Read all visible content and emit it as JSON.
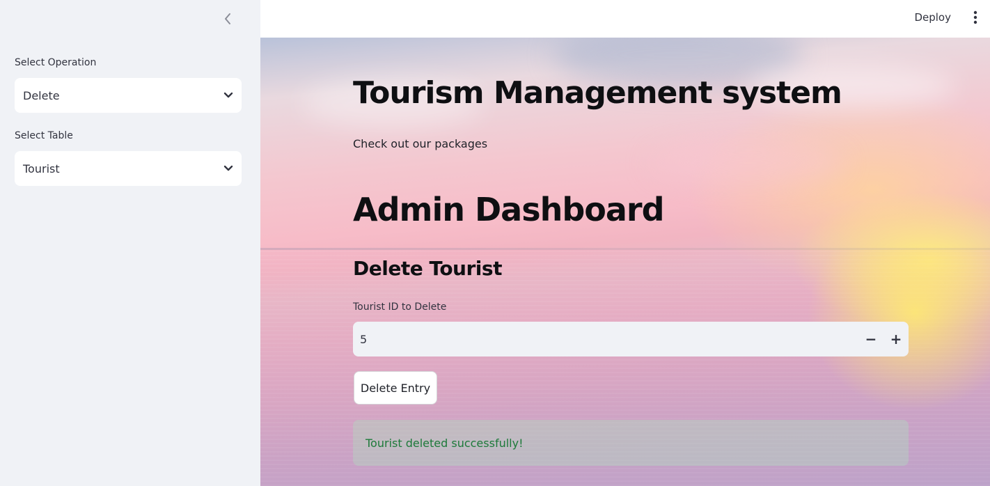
{
  "sidebar": {
    "collapse_icon": "chevron-left-icon",
    "operation": {
      "label": "Select Operation",
      "value": "Delete"
    },
    "table": {
      "label": "Select Table",
      "value": "Tourist"
    }
  },
  "header": {
    "deploy_label": "Deploy",
    "menu_icon": "kebab-menu-icon"
  },
  "main": {
    "title": "Tourism Management system",
    "subtitle": "Check out our packages",
    "dashboard_heading": "Admin Dashboard",
    "section_heading": "Delete Tourist",
    "id_field": {
      "label": "Tourist ID to Delete",
      "value": "5",
      "decrement": "−",
      "increment": "+"
    },
    "delete_button_label": "Delete Entry",
    "success_message": "Tourist deleted successfully!"
  },
  "colors": {
    "sidebar_bg": "#f0f2f6",
    "success_text": "#1d7a3a",
    "success_bg": "#ace6be"
  }
}
